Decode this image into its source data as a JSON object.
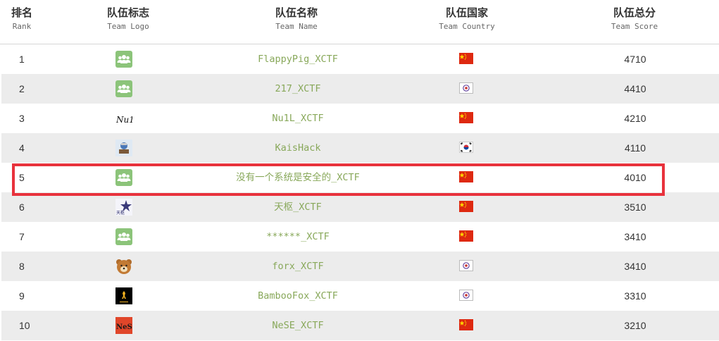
{
  "header": {
    "rank": {
      "cn": "排名",
      "en": "Rank"
    },
    "logo": {
      "cn": "队伍标志",
      "en": "Team Logo"
    },
    "name": {
      "cn": "队伍名称",
      "en": "Team Name"
    },
    "country": {
      "cn": "队伍国家",
      "en": "Team Country"
    },
    "score": {
      "cn": "队伍总分",
      "en": "Team Score"
    }
  },
  "rows": [
    {
      "rank": "1",
      "logo": "default-team-icon",
      "name": "FlappyPig_XCTF",
      "flag": "china-flag-icon",
      "score": "4710"
    },
    {
      "rank": "2",
      "logo": "default-team-icon",
      "name": "217_XCTF",
      "flag": "taiwan-flag-icon",
      "score": "4410"
    },
    {
      "rank": "3",
      "logo": "nu1l-logo",
      "name": "Nu1L_XCTF",
      "flag": "china-flag-icon",
      "score": "4210"
    },
    {
      "rank": "4",
      "logo": "kaishack-logo",
      "name": "KaisHack",
      "flag": "korea-flag-icon",
      "score": "4110"
    },
    {
      "rank": "5",
      "logo": "default-team-icon",
      "name": "没有一个系统是安全的_XCTF",
      "flag": "china-flag-icon",
      "score": "4010"
    },
    {
      "rank": "6",
      "logo": "tianshu-logo",
      "name": "天枢_XCTF",
      "flag": "china-flag-icon",
      "score": "3510"
    },
    {
      "rank": "7",
      "logo": "default-team-icon",
      "name": "******_XCTF",
      "flag": "china-flag-icon",
      "score": "3410"
    },
    {
      "rank": "8",
      "logo": "bear-logo",
      "name": "forx_XCTF",
      "flag": "taiwan-flag-icon",
      "score": "3410"
    },
    {
      "rank": "9",
      "logo": "bamboofox-logo",
      "name": "BambooFox_XCTF",
      "flag": "taiwan-flag-icon",
      "score": "3310"
    },
    {
      "rank": "10",
      "logo": "nese-logo",
      "name": "NeSE_XCTF",
      "flag": "china-flag-icon",
      "score": "3210"
    }
  ],
  "logo_text": {
    "nu1l": "Nu1L",
    "tianshu": "天枢",
    "nese": "NeSE"
  },
  "highlighted_rank": "5",
  "colors": {
    "team_name": "#88a85a",
    "highlight": "#e8323c",
    "even_row": "#ececec",
    "default_icon": "#8cc47a"
  }
}
